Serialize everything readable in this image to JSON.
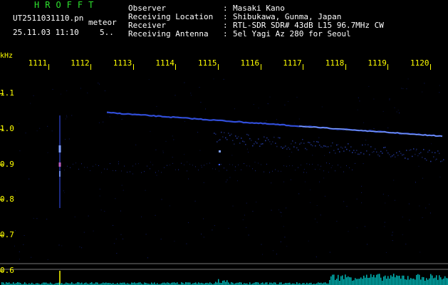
{
  "header": {
    "app_title": "HROFFT",
    "file_name": "UT2511031110.pn",
    "mode": "meteor",
    "date_time": "25.11.03 11:10",
    "dots": "5.."
  },
  "station_info": [
    {
      "key": "Observer",
      "value": "Masaki Kano"
    },
    {
      "key": "Receiving Location",
      "value": "Shibukawa, Gunma, Japan"
    },
    {
      "key": "Receiver",
      "value": "RTL-SDR SDR# 43dB L15 96.7MHz CW"
    },
    {
      "key": "Receiving Antenna",
      "value": "5el Yagi Az 280 for Seoul"
    }
  ],
  "info_separator": ":",
  "axes": {
    "unit": "kHz",
    "y_ticks": [
      "1.1",
      "1.0",
      "0.9",
      "0.8",
      "0.7",
      "0.6"
    ],
    "y_values": [
      1.1,
      1.0,
      0.9,
      0.8,
      0.7,
      0.6
    ],
    "x_ticks": [
      "1111",
      "1112",
      "1113",
      "1114",
      "1115",
      "1116",
      "1117",
      "1118",
      "1119",
      "1120"
    ],
    "x_tick_minutes": [
      1,
      2,
      3,
      4,
      5,
      6,
      7,
      8,
      9,
      10
    ]
  },
  "colors": {
    "background": "#000000",
    "axis": "#ffff00",
    "title": "#2ee22e",
    "text": "#ffffff",
    "trace": "#3a5cff",
    "trace_bright": "#8fb0ff",
    "meteor": "#7fa0ff",
    "baseline": "#00c8c8"
  }
}
